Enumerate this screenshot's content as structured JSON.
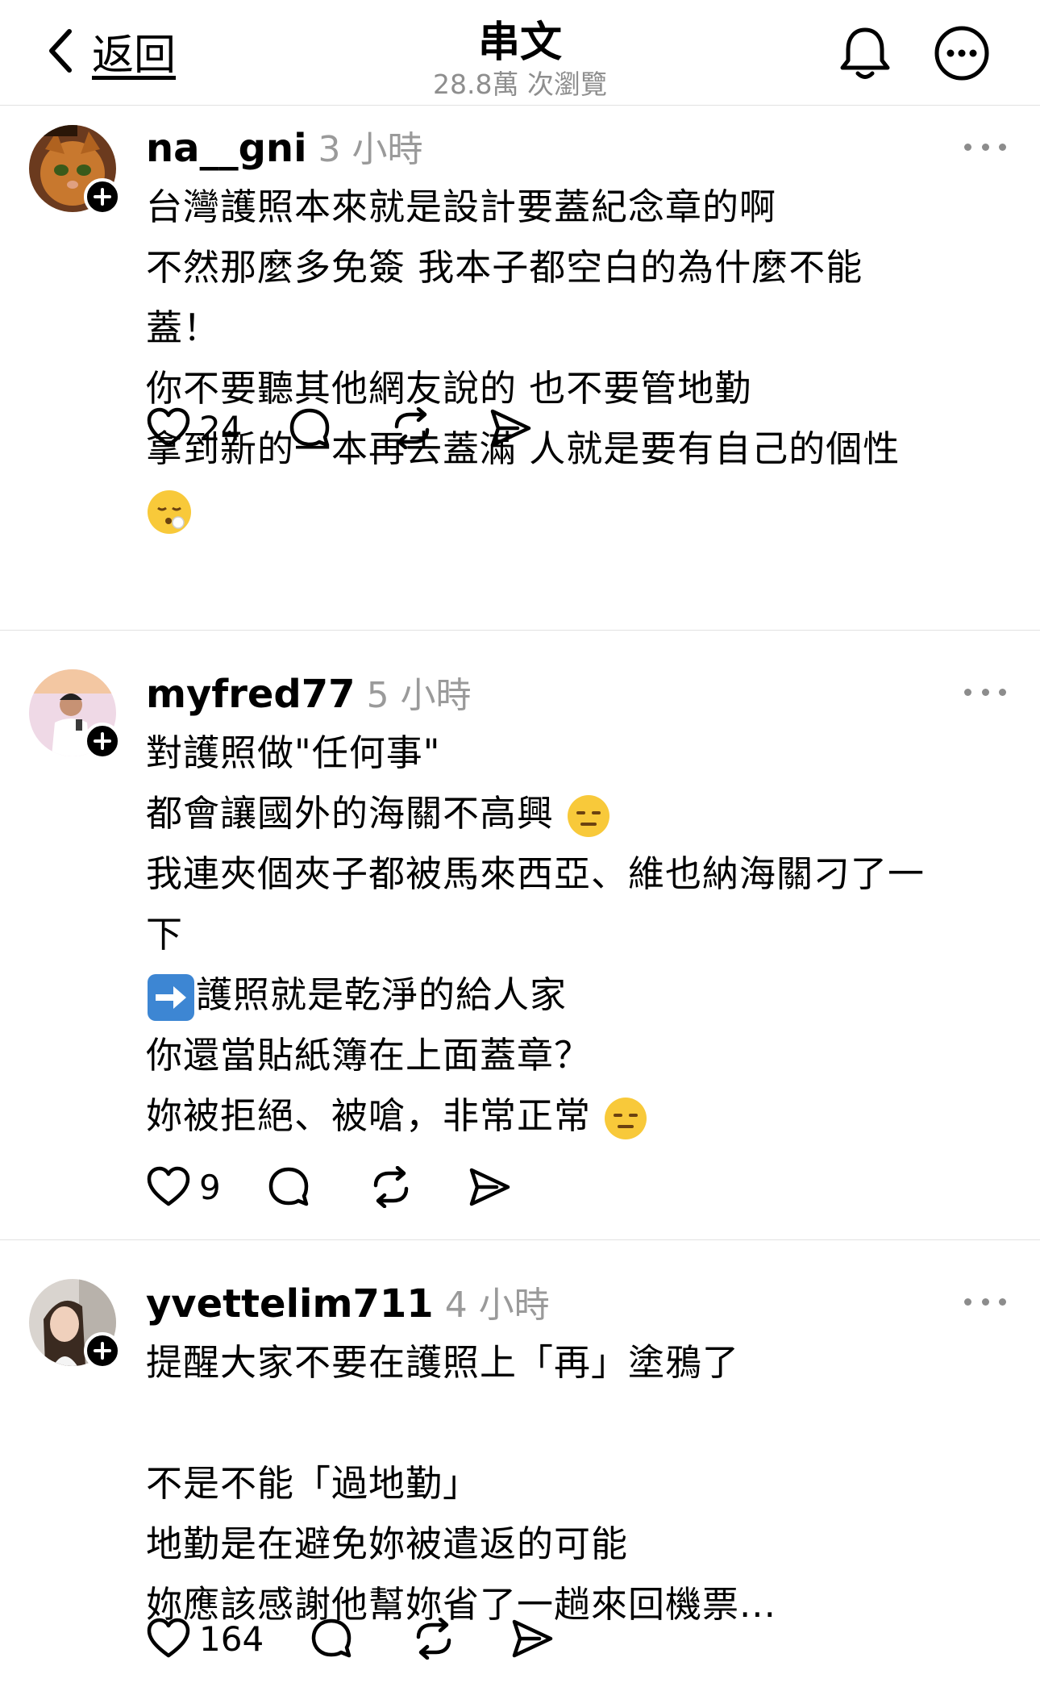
{
  "header": {
    "back_label": "返回",
    "title": "串文",
    "views": "28.8萬 次瀏覽"
  },
  "posts": [
    {
      "username": "na__gni",
      "time": "3 小時",
      "lines": [
        "台灣護照本來就是設計要蓋紀念章的啊",
        "不然那麼多免簽 我本子都空白的為什麼不能",
        "蓋！",
        "你不要聽其他網友說的 也不要管地勤",
        "拿到新的一本再去蓋滿 人就是要有自己的個性",
        ""
      ],
      "likes": "24"
    },
    {
      "username": "myfred77",
      "time": "5 小時",
      "lines": [
        "對護照做\"任何事\"",
        "都會讓國外的海關不高興",
        "我連夾個夾子都被馬來西亞、維也納海關刁了一",
        "下",
        "護照就是乾淨的給人家",
        "你還當貼紙簿在上面蓋章？",
        "妳被拒絕、被嗆，非常正常"
      ],
      "likes": "9"
    },
    {
      "username": "yvettelim711",
      "time": "4 小時",
      "lines": [
        "提醒大家不要在護照上「再」塗鴉了",
        "",
        "不是不能「過地勤」",
        "地勤是在避免妳被遣返的可能",
        "妳應該感謝他幫妳省了一趟來回機票..."
      ],
      "likes": "164"
    }
  ],
  "icons": {
    "emoji_post1": "face-exhaling-emoji",
    "emoji_expressionless": "expressionless-face-emoji",
    "emoji_arrow": "right-arrow-emoji"
  }
}
